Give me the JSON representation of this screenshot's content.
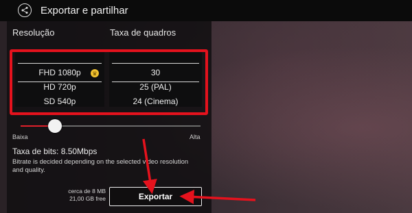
{
  "header": {
    "title": "Exportar e partilhar",
    "share_icon": "share-icon"
  },
  "resolution": {
    "label": "Resolução",
    "options": [
      "FHD 1080p",
      "HD 720p",
      "SD 540p"
    ],
    "selected": "FHD 1080p",
    "premium_icon": "crown-icon"
  },
  "frame_rate": {
    "label": "Taxa de quadros",
    "options": [
      "30",
      "25 (PAL)",
      "24 (Cinema)"
    ],
    "selected": "30"
  },
  "quality_slider": {
    "min_label": "Baixa",
    "max_label": "Alta",
    "level": 0.19
  },
  "bitrate": {
    "label": "Taxa de bits: 8.50Mbps",
    "description": "Bitrate is decided depending on the selected video resolution and quality."
  },
  "footer": {
    "estimated_size": "cerca de 8 MB",
    "free_space": "21,00 GB free",
    "export_label": "Exportar"
  },
  "colors": {
    "annotation": "#e5121d",
    "slider_fill": "#e0202a",
    "premium": "#f2c230"
  }
}
